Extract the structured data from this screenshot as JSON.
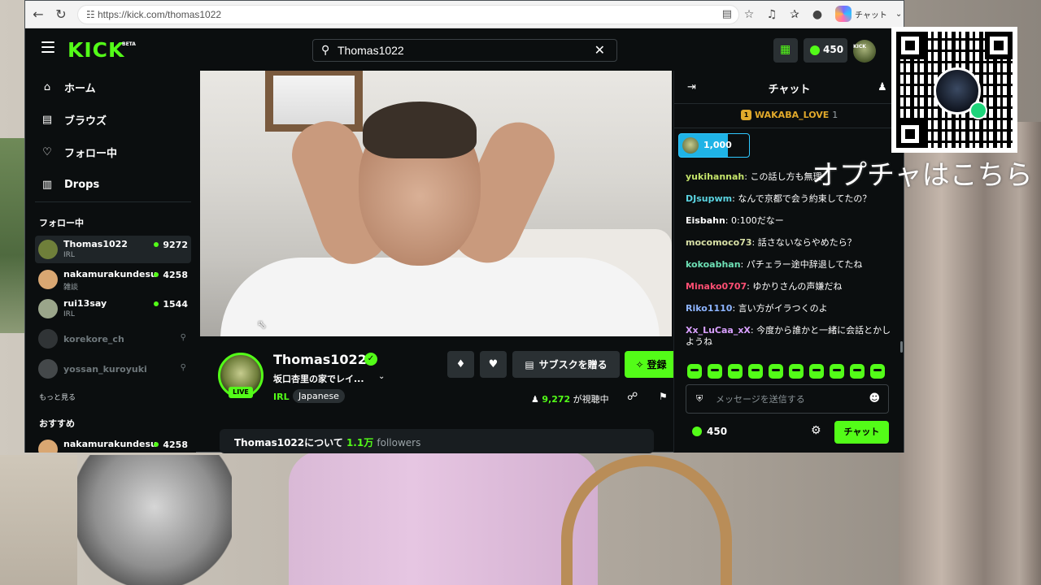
{
  "browser": {
    "url": "https://kick.com/thomas1022",
    "copilot_label": "チャット"
  },
  "header": {
    "logo": "KICK",
    "logo_badge": "BETA",
    "search_value": "Thomas1022",
    "kicks_balance": "450",
    "avatar_tag": "KICK"
  },
  "sidebar": {
    "nav": [
      {
        "label": "ホーム",
        "icon": "home-icon"
      },
      {
        "label": "ブラウズ",
        "icon": "browse-icon"
      },
      {
        "label": "フォロー中",
        "icon": "heart-icon"
      },
      {
        "label": "Drops",
        "icon": "drops-icon"
      }
    ],
    "following_heading": "フォロー中",
    "following": [
      {
        "name": "Thomas1022",
        "category": "IRL",
        "viewers": "9272",
        "live": true,
        "avatar_color": "#6f7f3a"
      },
      {
        "name": "nakamurakundesu",
        "category": "雑談",
        "viewers": "4258",
        "live": true,
        "avatar_color": "#d9a772"
      },
      {
        "name": "rui13say",
        "category": "IRL",
        "viewers": "1544",
        "live": true,
        "avatar_color": "#9aa58a"
      },
      {
        "name": "korekore_ch",
        "live": false,
        "avatar_color": "#555a5e"
      },
      {
        "name": "yossan_kuroyuki",
        "live": false,
        "avatar_color": "#7d8285"
      }
    ],
    "show_more": "もっと見る",
    "recommended_heading": "おすすめ",
    "recommended": [
      {
        "name": "nakamurakundesu",
        "viewers": "4258",
        "avatar_color": "#d9a772"
      }
    ]
  },
  "stream": {
    "streamer": "Thomas1022",
    "title": "坂口杏里の家でレイ...",
    "live_badge": "LIVE",
    "category": "IRL",
    "language": "Japanese",
    "viewer_count": "9,272",
    "viewer_suffix": "が視聴中",
    "subscribe_gift_label": "サブスクを贈る",
    "follow_label": "登録",
    "about_title": "Thomas1022について",
    "followers_count": "1.1万",
    "followers_label": "followers"
  },
  "chat": {
    "title": "チャット",
    "pinned_gifter": {
      "name": "WAKABA_LOVE",
      "count": "1"
    },
    "gift_amount": "1,000",
    "messages": [
      {
        "user": "yukihannah",
        "text": "この話し方も無理",
        "color": "#c4e36a"
      },
      {
        "user": "DJsupwm",
        "text": "なんで京都で会う約束してたの？",
        "color": "#5ad3e0"
      },
      {
        "user": "Eisbahn",
        "text": "0:100だなー",
        "color": "#ffffff"
      },
      {
        "user": "mocomoco73",
        "text": "話さないならやめたら？",
        "color": "#d8e0a6"
      },
      {
        "user": "kokoabhan",
        "text": "パチェラー途中辞退してたね",
        "color": "#6ee0b5"
      },
      {
        "user": "Minako0707",
        "text": "ゆかりさんの声嫌だね",
        "color": "#ff4f73"
      },
      {
        "user": "Riko1110",
        "text": "言い方がイラつくのよ",
        "color": "#8db4ff"
      },
      {
        "user": "Xx_LuCaa_xX",
        "text": "今度から誰かと一緒に会話とかしようね",
        "color": "#d9a0ff"
      }
    ],
    "input_placeholder": "メッセージを送信する",
    "kicks_balance": "450",
    "send_label": "チャット"
  },
  "overlay": {
    "promo_text": "オプチャはこちら"
  },
  "colors": {
    "accent": "#53fc18",
    "background": "#0b0e0f",
    "surface": "#2a3033"
  }
}
